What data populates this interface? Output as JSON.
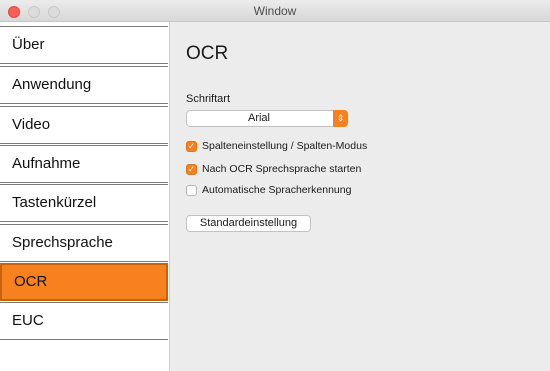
{
  "window": {
    "title": "Window"
  },
  "sidebar": {
    "items": [
      {
        "label": "Über"
      },
      {
        "label": "Anwendung"
      },
      {
        "label": "Video"
      },
      {
        "label": "Aufnahme"
      },
      {
        "label": "Tastenkürzel"
      },
      {
        "label": "Sprechsprache"
      },
      {
        "label": "OCR",
        "selected": true
      },
      {
        "label": "EUC"
      }
    ]
  },
  "main": {
    "title": "OCR",
    "font_label": "Schriftart",
    "font_select": {
      "value": "Arial",
      "icon": "chevron-updown-icon"
    },
    "checkboxes": [
      {
        "label": "Spalteneinstellung / Spalten-Modus",
        "checked": true
      },
      {
        "label": "Nach OCR Sprechsprache starten",
        "checked": true
      },
      {
        "label": "Automatische Spracherkennung",
        "checked": false
      }
    ],
    "default_button": "Standardeinstellung"
  },
  "colors": {
    "accent": "#f6811e",
    "close_button": "#fd5f57"
  }
}
